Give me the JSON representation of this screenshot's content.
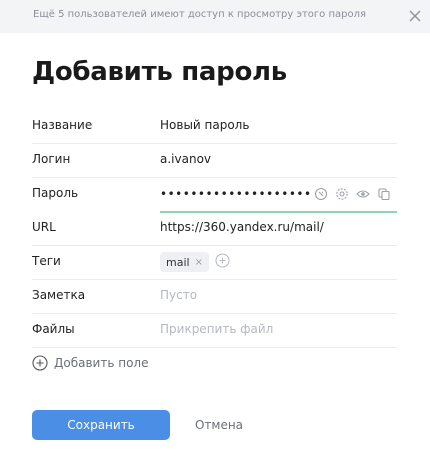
{
  "banner": {
    "text": "Ещё 5 пользователей имеют доступ к просмотру этого пароля",
    "close_icon": "close-icon"
  },
  "title": "Добавить пароль",
  "fields": {
    "name": {
      "label": "Название",
      "value": "Новый пароль"
    },
    "login": {
      "label": "Логин",
      "value": "a.ivanov"
    },
    "password": {
      "label": "Пароль",
      "value": "••••••••••••••••••••",
      "icons": [
        "generate-icon",
        "settings-icon",
        "eye-icon",
        "copy-icon"
      ]
    },
    "url": {
      "label": "URL",
      "value": "https://360.yandex.ru/mail/"
    },
    "tags": {
      "label": "Теги",
      "items": [
        "mail"
      ],
      "remove_glyph": "×",
      "add_icon": "add-tag-icon"
    },
    "note": {
      "label": "Заметка",
      "placeholder": "Пусто"
    },
    "files": {
      "label": "Файлы",
      "placeholder": "Прикрепить файл"
    }
  },
  "add_field": {
    "label": "Добавить поле",
    "icon": "plus-circle-icon"
  },
  "buttons": {
    "save": "Сохранить",
    "cancel": "Отмена"
  },
  "colors": {
    "accent": "#4a8ee6",
    "banner_bg": "#f3f4f6",
    "password_underline": "#8ed3b5"
  }
}
